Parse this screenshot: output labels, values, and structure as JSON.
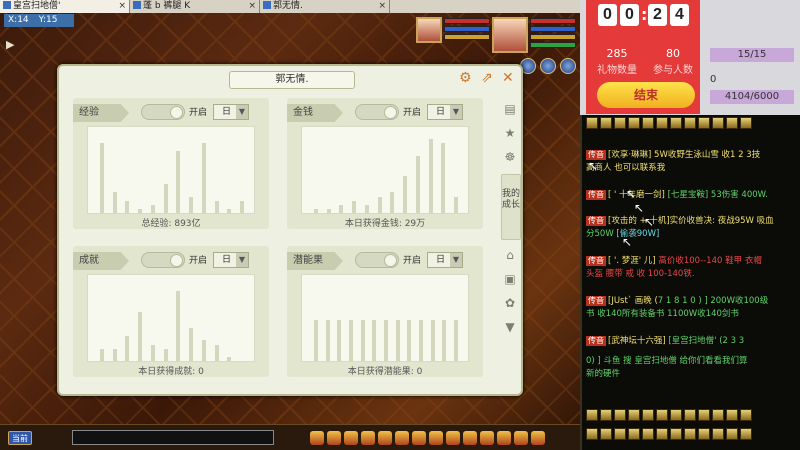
{
  "window_tabs": [
    {
      "label": "皇宫扫地僧'"
    },
    {
      "label": "蓬 b 裤腿 K"
    },
    {
      "label": "郭无情."
    }
  ],
  "map": {
    "x_label": "X:14",
    "y_label": "Y:15"
  },
  "dialog": {
    "title": "郭无情.",
    "side_tab": "我的成长",
    "panels": [
      {
        "title": "经验",
        "toggle_label": "开启",
        "period": "日",
        "caption": "总经验: 893亿",
        "bars": [
          0.85,
          0.25,
          0.15,
          0.05,
          0.1,
          0.35,
          0.75,
          0.2,
          0.85,
          0.15,
          0.05,
          0.15
        ]
      },
      {
        "title": "金钱",
        "toggle_label": "开启",
        "period": "日",
        "caption": "本日获得金钱: 29万",
        "bars": [
          0.05,
          0.05,
          0.1,
          0.15,
          0.1,
          0.2,
          0.25,
          0.45,
          0.7,
          0.9,
          0.85,
          0.2
        ]
      },
      {
        "title": "成就",
        "toggle_label": "开启",
        "period": "日",
        "caption": "本日获得成就: 0",
        "bars": [
          0.15,
          0.15,
          0.3,
          0.6,
          0.2,
          0.15,
          0.85,
          0.4,
          0.25,
          0.2,
          0.05,
          0.0
        ]
      },
      {
        "title": "潜能果",
        "toggle_label": "开启",
        "period": "日",
        "caption": "本日获得潜能果: 0",
        "bars": [
          0.5,
          0.5,
          0.5,
          0.5,
          0.5,
          0.5,
          0.5,
          0.5,
          0.5,
          0.5,
          0.5,
          0.5,
          0.5
        ]
      }
    ]
  },
  "bottom": {
    "channel_btn": "当前"
  },
  "overlay": {
    "timer_digits": [
      "0",
      "0",
      "2",
      "4"
    ],
    "gift_count": "285",
    "gift_label": "礼物数量",
    "participants": "80",
    "participants_label": "参与人数",
    "end_button": "结束",
    "progress_a": "15/15",
    "progress_b": "4104/6000",
    "side_char": "0"
  },
  "chat": {
    "tag": "传音",
    "messages": [
      {
        "a": "[欢享·琳琳]",
        "b": " 5W收野生泳山雪  收1 2 3技"
      },
      {
        "a": "高商人",
        "b": " 也可以联系我"
      },
      {
        "a": "[ ' 十年磨一剑]",
        "b": " [七星宝鞍] 53伤害 400W."
      },
      {
        "a": "[攻击的 + 十机]",
        "b": "实价收兽决: 夜战95W 吸血"
      },
      {
        "a": "分50W",
        "b": " [偷袭90W]"
      },
      {
        "a": "[ '. 梦涯' 儿]",
        "b": " 高价收100--140 鞋甲 衣帽"
      },
      {
        "a": "头盔 腰带 戒",
        "b": "  收  100-140铁."
      },
      {
        "a": "[JUst` 画晚 (",
        "b": "7 1 8 1 0 ) ]  200W收100级"
      },
      {
        "a": "书  收140所有装备书",
        "b": "  1100W收140剑书"
      },
      {
        "a": "[武神坛十六强]",
        "b": " [皇宫扫地僧' (2 3 3"
      },
      {
        "a": "0) ]  斗鱼  搜  皇宫扫地僧",
        "b": "  给你们看看我们算"
      },
      {
        "a": "新的硬件",
        "b": ""
      }
    ]
  }
}
